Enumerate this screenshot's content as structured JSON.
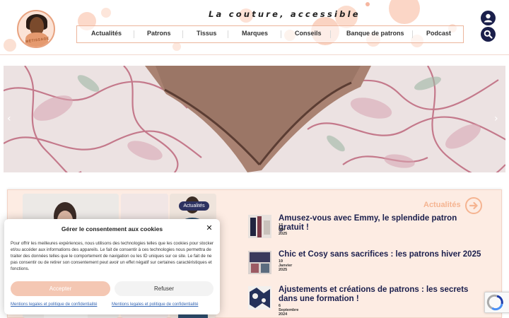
{
  "header": {
    "tagline": "La couture, accessible",
    "logo_text": "MÉTISSAGE",
    "nav": [
      "Actualités",
      "Patrons",
      "Tissus",
      "Marques",
      "Conseils",
      "Banque de patrons",
      "Podcast"
    ]
  },
  "hero": {
    "prev_arrow": "‹",
    "next_arrow": "›"
  },
  "news": {
    "tag": "Actualités",
    "section_title": "Actualités",
    "articles": [
      {
        "title": "Amusez-vous avec Emmy, le splendide patron gratuit !",
        "date": "17 Mai 2025"
      },
      {
        "title": "Chic et Cosy sans sacrifices : les patrons hiver 2025",
        "date": "19 Janvier 2025"
      },
      {
        "title": "Ajustements et créations de patrons : les secrets dans une formation !",
        "date": "6 Septembre 2024"
      }
    ]
  },
  "consent": {
    "title": "Gérer le consentement aux cookies",
    "close": "✕",
    "body": "Pour offrir les meilleures expériences, nous utilisons des technologies telles que les cookies pour stocker et/ou accéder aux informations des appareils. Le fait de consentir à ces technologies nous permettra de traiter des données telles que le comportement de navigation ou les ID uniques sur ce site. Le fait de ne pas consentir ou de retirer son consentement peut avoir un effet négatif sur certaines caractéristiques et fonctions.",
    "accept": "Accepter",
    "refuse": "Refuser",
    "link1": "Mentions legales et politique de confidentialité",
    "link2": "Mentions legales et politique de confidentialité"
  },
  "colors": {
    "accent_peach": "#f5b491",
    "navy": "#1b1f4d",
    "panel_bg": "#fdece3"
  },
  "icons": [
    "user-icon",
    "search-icon",
    "logo",
    "chevron-left-icon",
    "chevron-right-icon",
    "arrow-right-circle-icon",
    "close-icon",
    "recaptcha-icon"
  ]
}
